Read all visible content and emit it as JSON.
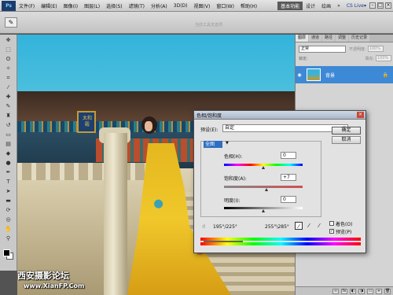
{
  "app": {
    "logo": "Ps"
  },
  "menu": [
    "文件(F)",
    "编辑(E)",
    "图像(I)",
    "图层(L)",
    "选择(S)",
    "滤镜(T)",
    "分析(A)",
    "3D(D)",
    "视图(V)",
    "窗口(W)",
    "帮助(H)"
  ],
  "workspaces": {
    "active": "基本功能",
    "others": [
      "设计",
      "绘画",
      "»"
    ],
    "cslive": "CS Live▾"
  },
  "options": {
    "hint": "当前工具无选项"
  },
  "layers_panel": {
    "tabs": [
      "图层",
      "通道",
      "路径",
      "调整",
      "历史记录"
    ],
    "blend_mode": "正常",
    "opacity_label": "不透明度:",
    "opacity_value": "100%",
    "lock_label": "锁定:",
    "fill_label": "填充:",
    "fill_value": "100%",
    "layer_name": "背景"
  },
  "photo": {
    "plaque": "太和殿",
    "watermark_cn": "西安摄影论坛",
    "watermark_url": "www.XianFP.Com"
  },
  "dialog": {
    "title": "色相/饱和度",
    "preset_label": "预设(E):",
    "preset_value": "自定",
    "ok": "确定",
    "cancel": "取消",
    "channel": "全图",
    "hue_label": "色相(H):",
    "hue_value": "0",
    "saturation_label": "饱和度(A):",
    "saturation_value": "+7",
    "lightness_label": "明度(I):",
    "lightness_value": "0",
    "range_left": "195°/225°",
    "range_right": "255°\\285°",
    "colorize_label": "着色(O)",
    "preview_label": "预览(P)"
  }
}
